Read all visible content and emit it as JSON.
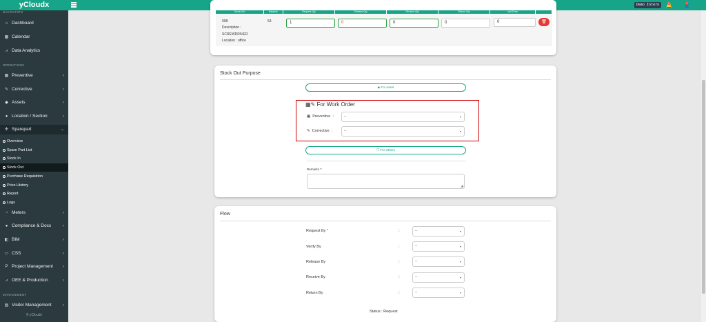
{
  "app": {
    "brand": "yCloudx"
  },
  "topbar": {
    "user_label": "Demo Intern",
    "notif_count_1": "9",
    "notif_count_2": "1"
  },
  "sidebar": {
    "top_label": "NAVIGATION",
    "dashboard": "Dashboard",
    "calendar": "Calendar",
    "data_analytics": "Data Analytics",
    "operations_label": "OPERATIONS",
    "preventive": "Preventive",
    "corrective": "Corrective",
    "assets": "Assets",
    "location": "Location / Section",
    "sparepart": "Sparepart",
    "sub": {
      "overview": "Overview",
      "spare_part_list": "Spare Part List",
      "stock_in": "Stock In",
      "stock_out": "Stock Out",
      "purchase_requisition": "Purchase Requisition",
      "price_history": "Price History",
      "report": "Report",
      "logs": "Logs"
    },
    "meters": "Meters",
    "compliance": "Compliance & Docs",
    "bim": "BIM",
    "css": "CSS",
    "project_management": "Project Management",
    "oee": "OEE & Production",
    "management_label": "MANAGEMENT",
    "visitor_management": "Visitor Management",
    "footer": "© yCloudx"
  },
  "stock_table": {
    "headers": [
      "Stock Info",
      "Balance",
      "Request Qty",
      "Release Qty",
      "Receive Qty",
      "Return Qty",
      "Unit Price",
      ""
    ],
    "row": {
      "code": "008",
      "description_label": "Description :",
      "description": "SCREWDRIVER",
      "location": "Location : office",
      "balance": "53",
      "request_qty": "1",
      "release_qty": "0",
      "receive_qty": "0",
      "return_qty": "0",
      "unit_price": "0"
    }
  },
  "purpose": {
    "title": "Stock Out Purpose",
    "for_asset": "For Asset",
    "work_order_title": "For Work Order",
    "preventive_label": "Preventive",
    "corrective_label": "Corrective",
    "preventive_value": "--",
    "corrective_value": "--",
    "for_others": "For Others",
    "remarks_label": "Remarks *:"
  },
  "flow": {
    "title": "Flow",
    "rows": [
      {
        "label": "Request By",
        "value": "--"
      },
      {
        "label": "Verify By",
        "value": "--"
      },
      {
        "label": "Release By",
        "value": "--"
      },
      {
        "label": "Receive By",
        "value": "--"
      },
      {
        "label": "Return By",
        "value": "--"
      }
    ],
    "colon": ":",
    "status": "Status : Request"
  },
  "colors": {
    "primary": "#17a589",
    "sidebar": "#2b3a3f",
    "danger": "#e53935",
    "highlight_border": "#cc0000"
  }
}
